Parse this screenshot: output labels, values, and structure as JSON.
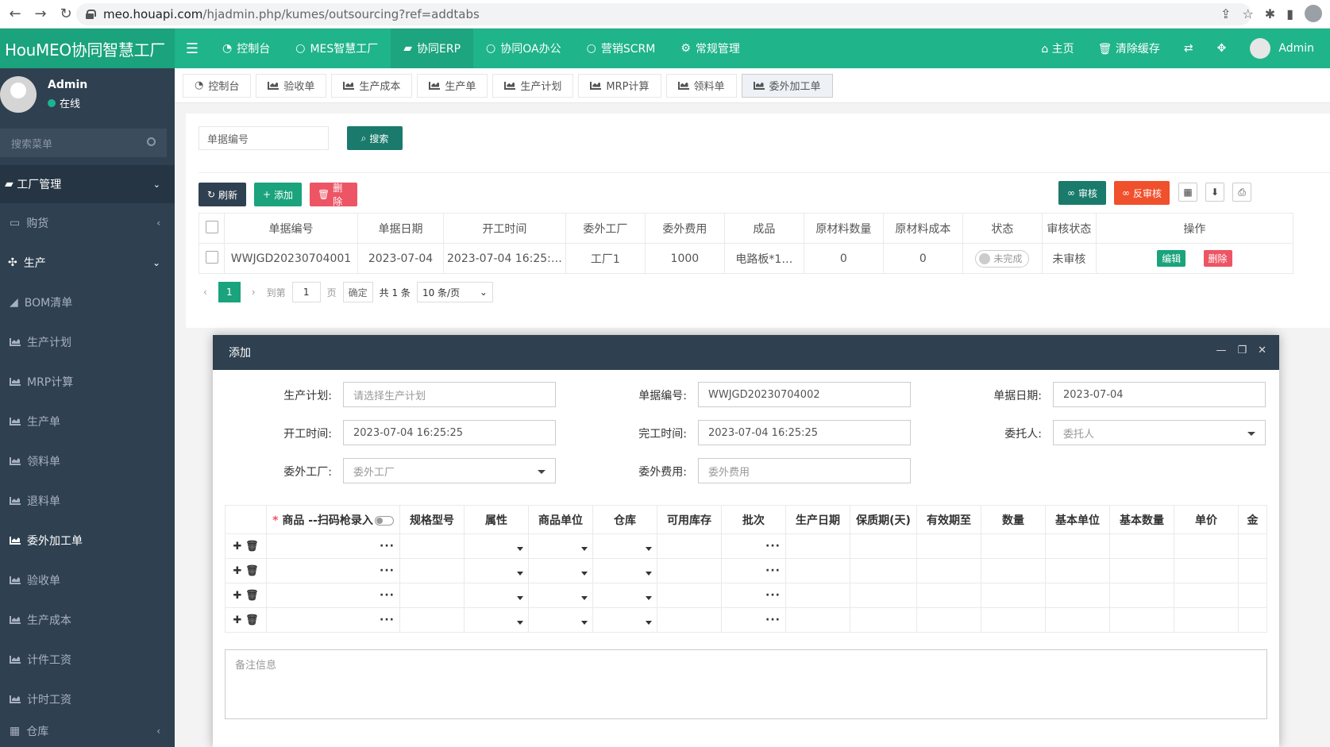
{
  "browser": {
    "url_host": "meo.houapi.com",
    "url_path": "/hjadmin.php/kumes/outsourcing?ref=addtabs"
  },
  "header": {
    "brand": "HouMEO协同智慧工厂",
    "menu": [
      {
        "label": "控制台",
        "icon": "dashboard-icon"
      },
      {
        "label": "MES智慧工厂",
        "icon": "circle-icon"
      },
      {
        "label": "协同ERP",
        "icon": "graduation-cap-icon"
      },
      {
        "label": "协同OA办公",
        "icon": "circle-icon"
      },
      {
        "label": "营销SCRM",
        "icon": "circle-icon"
      },
      {
        "label": "常规管理",
        "icon": "cogs-icon"
      }
    ],
    "right": {
      "home": "主页",
      "clear_cache": "清除缓存",
      "admin": "Admin"
    }
  },
  "sidebar": {
    "user_name": "Admin",
    "user_status": "在线",
    "search_placeholder": "搜索菜单",
    "group": "工厂管理",
    "items": [
      {
        "label": "购货"
      },
      {
        "label": "生产"
      },
      {
        "label": "BOM清单"
      },
      {
        "label": "生产计划"
      },
      {
        "label": "MRP计算"
      },
      {
        "label": "生产单"
      },
      {
        "label": "领料单"
      },
      {
        "label": "退料单"
      },
      {
        "label": "委外加工单"
      },
      {
        "label": "验收单"
      },
      {
        "label": "生产成本"
      },
      {
        "label": "计件工资"
      },
      {
        "label": "计时工资"
      },
      {
        "label": "仓库"
      }
    ]
  },
  "tabs": [
    "控制台",
    "验收单",
    "生产成本",
    "生产单",
    "生产计划",
    "MRP计算",
    "领料单",
    "委外加工单"
  ],
  "list": {
    "search_placeholder": "单据编号",
    "search_btn": "搜索",
    "refresh": "刷新",
    "add": "添加",
    "delete": "删除",
    "audit": "审核",
    "unaudit": "反审核",
    "columns": [
      "单据编号",
      "单据日期",
      "开工时间",
      "委外工厂",
      "委外费用",
      "成品",
      "原材料数量",
      "原材料成本",
      "状态",
      "审核状态",
      "操作"
    ],
    "rows": [
      {
        "code": "WWJGD20230704001",
        "date": "2023-07-04",
        "start": "2023-07-04 16:25:…",
        "factory": "工厂1",
        "fee": "1000",
        "product": "电路板*1…",
        "material_qty": "0",
        "material_cost": "0",
        "status": "未完成",
        "audit_status": "未审核",
        "edit": "编辑",
        "del": "删除"
      }
    ],
    "pager": {
      "page": "1",
      "goto": "到第",
      "page_input": "1",
      "page_unit": "页",
      "confirm": "确定",
      "total": "共 1 条",
      "per_page": "10 条/页"
    }
  },
  "modal": {
    "title": "添加",
    "fields": {
      "plan_label": "生产计划:",
      "plan_placeholder": "请选择生产计划",
      "code_label": "单据编号:",
      "code_value": "WWJGD20230704002",
      "date_label": "单据日期:",
      "date_value": "2023-07-04",
      "start_label": "开工时间:",
      "start_value": "2023-07-04 16:25:25",
      "finish_label": "完工时间:",
      "finish_value": "2023-07-04 16:25:25",
      "client_label": "委托人:",
      "client_placeholder": "委托人",
      "factory_label": "委外工厂:",
      "factory_placeholder": "委外工厂",
      "fee_label": "委外费用:",
      "fee_placeholder": "委外费用"
    },
    "item_columns": [
      "商品 --扫码枪录入",
      "规格型号",
      "属性",
      "商品单位",
      "仓库",
      "可用库存",
      "批次",
      "生产日期",
      "保质期(天)",
      "有效期至",
      "数量",
      "基本单位",
      "基本数量",
      "单价",
      "金"
    ],
    "remark_placeholder": "备注信息"
  }
}
